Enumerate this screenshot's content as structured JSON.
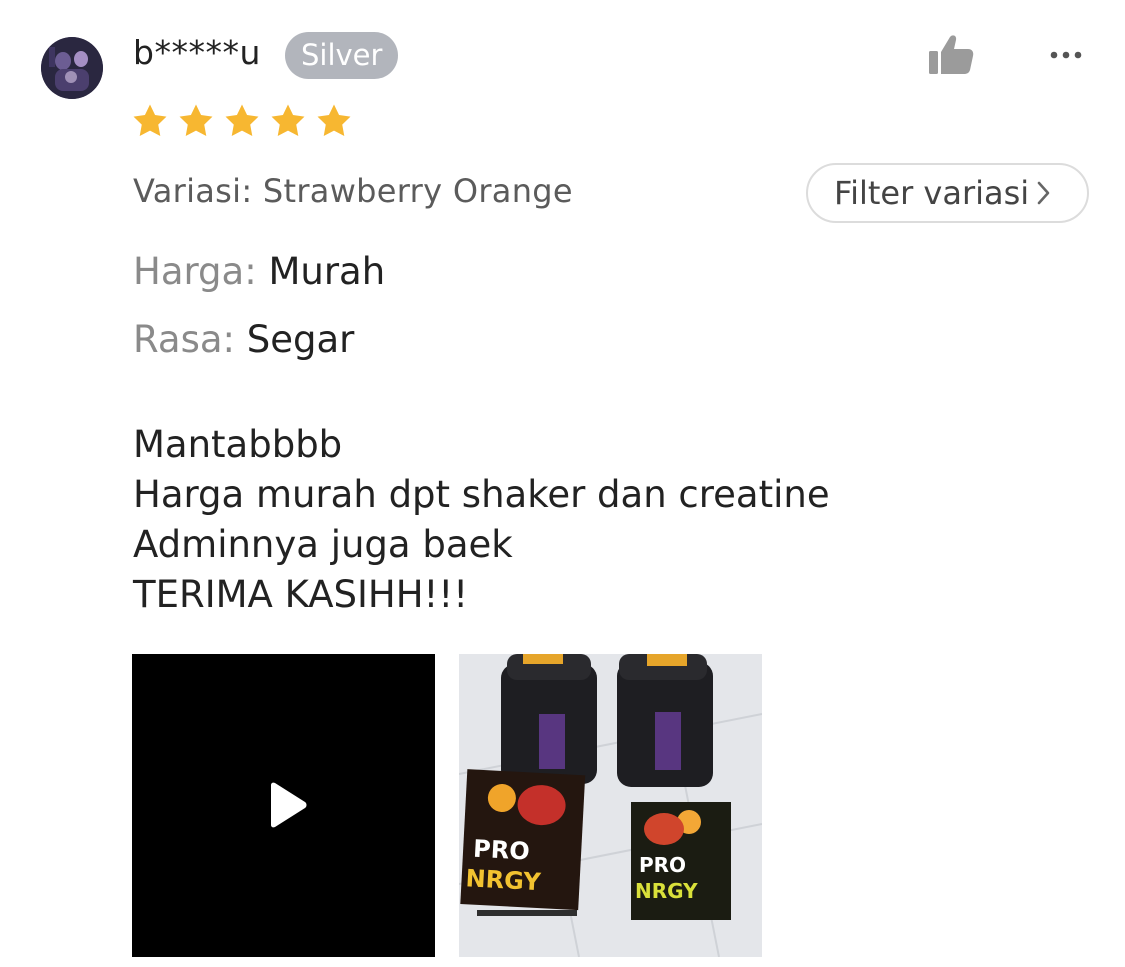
{
  "review": {
    "username": "b*****u",
    "badge": "Silver",
    "rating": 5,
    "rating_max": 5,
    "variation": "Variasi: Strawberry Orange",
    "filter_label": "Filter variasi",
    "attributes": [
      {
        "key": "Harga:",
        "value": "Murah"
      },
      {
        "key": "Rasa:",
        "value": "Segar"
      }
    ],
    "comment_lines": [
      "Mantabbbb",
      "Harga murah dpt shaker dan creatine",
      "Adminnya juga baek",
      "TERIMA KASIHH!!!"
    ],
    "media": [
      {
        "type": "video",
        "icon": "play-icon"
      },
      {
        "type": "photo",
        "printed_text": [
          "PRO",
          "NRGY"
        ]
      }
    ]
  },
  "icons": {
    "like": "thumbs-up-icon",
    "more": "more-horizontal-icon",
    "chevron": "chevron-right-icon"
  },
  "colors": {
    "star": "#F7B731",
    "badge_bg": "#B2B5BC",
    "icon_gray": "#9B9B9B",
    "label_gray": "#8A8A8A",
    "text": "#222222"
  }
}
